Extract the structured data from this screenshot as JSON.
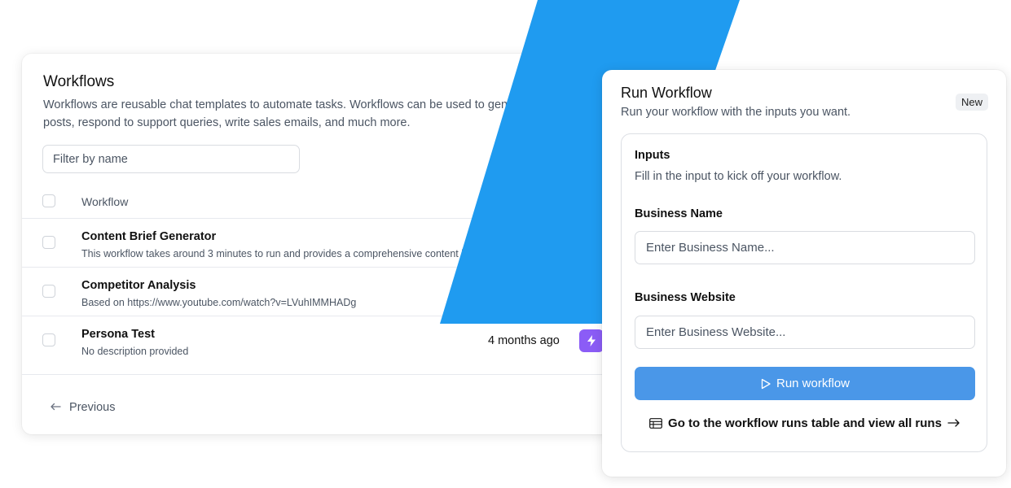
{
  "workflows": {
    "title": "Workflows",
    "description": "Workflows are reusable chat templates to automate tasks. Workflows can be used to generate long-form blog posts, respond to support queries, write sales emails, and much more.",
    "filter_placeholder": "Filter by name",
    "column_workflow": "Workflow",
    "rows": [
      {
        "name": "Content Brief Generator",
        "description": "This workflow takes around 3 minutes to run and provides a comprehensive content brief",
        "time": ""
      },
      {
        "name": "Competitor Analysis",
        "description": "Based on https://www.youtube.com/watch?v=LVuhIMMHADg",
        "time": ""
      },
      {
        "name": "Persona Test",
        "description": "No description provided",
        "time": "4 months ago"
      }
    ],
    "previous_label": "Previous"
  },
  "run": {
    "title": "Run Workflow",
    "subtitle": "Run your workflow with the inputs you want.",
    "badge": "New",
    "inputs_title": "Inputs",
    "inputs_subtitle": "Fill in the input to kick off your workflow.",
    "fields": [
      {
        "label": "Business Name",
        "placeholder": "Enter Business Name...",
        "value": ""
      },
      {
        "label": "Business Website",
        "placeholder": "Enter Business Website...",
        "value": ""
      }
    ],
    "run_button": "Run workflow",
    "runs_link": "Go to the workflow runs table and view all runs"
  },
  "colors": {
    "accent_blue": "#1f9bf0",
    "button_blue": "#4a97e8",
    "bolt_purple": "#8b5cf6"
  },
  "icons": {
    "bolt": "lightning-bolt-icon",
    "play": "play-icon",
    "table": "table-icon",
    "arrow_right": "arrow-right-icon",
    "arrow_left": "arrow-left-icon"
  }
}
